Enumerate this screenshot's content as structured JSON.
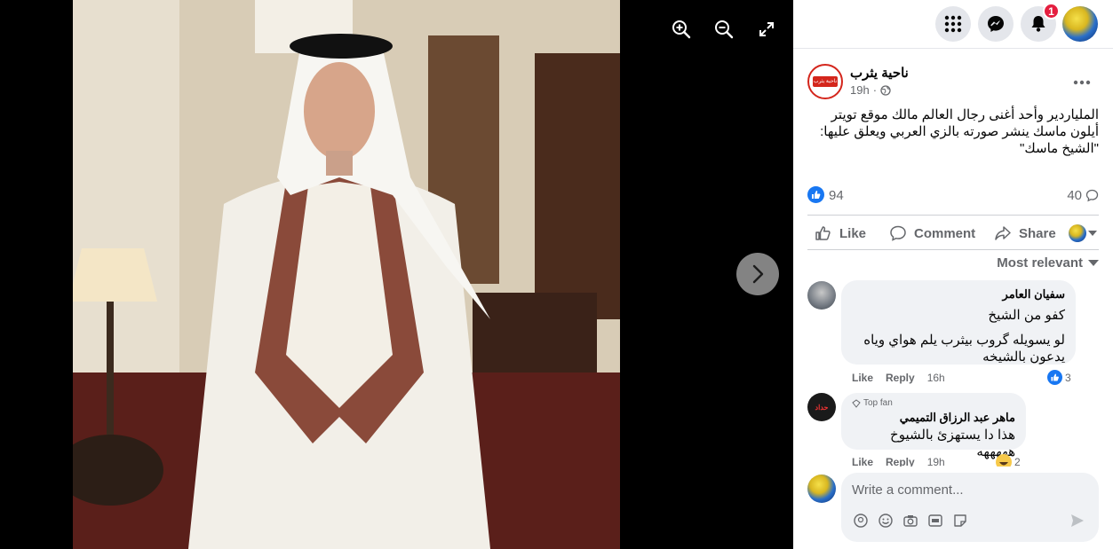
{
  "viewer": {
    "icons": [
      "zoom-in-icon",
      "zoom-out-icon",
      "fullscreen-icon",
      "chevron-right-icon"
    ]
  },
  "topbar": {
    "notifications_count": "1"
  },
  "post": {
    "page_name": "ناحية يثرب",
    "logo_text": "ناحية يثرب",
    "time": "19h",
    "text_line1": "الملياردير وأحد أغنى رجال العالم مالك موقع تويتر",
    "text_line2": "أيلون ماسك ينشر صورته بالزي العربي ويعلق عليها:",
    "text_line3": "\"الشيخ ماسك\"",
    "like_count": "94",
    "comment_count": "40"
  },
  "actions": {
    "like_label": "Like",
    "comment_label": "Comment",
    "share_label": "Share"
  },
  "sort": {
    "label": "Most relevant"
  },
  "comments": [
    {
      "author": "سفيان العامر",
      "line1": "كفو من الشيخ",
      "line2": "لو يسويله گروب بيثرب يلم هواي وياه",
      "line3": "يدعون بالشيخه",
      "like_label": "Like",
      "reply_label": "Reply",
      "time": "16h",
      "reactions": "3"
    },
    {
      "badge": "Top fan",
      "avatar_text": "حداد",
      "author": "ماهر عبد الرزاق التميمي",
      "line1": "هذا دا يستهزئ بالشيوخ هههههه",
      "like_label": "Like",
      "reply_label": "Reply",
      "time": "19h",
      "reactions": "2"
    }
  ],
  "composer": {
    "placeholder": "Write a comment..."
  },
  "colors": {
    "accent": "#1877f2",
    "badge": "#e41e3f",
    "secondary_text": "#65676b"
  }
}
